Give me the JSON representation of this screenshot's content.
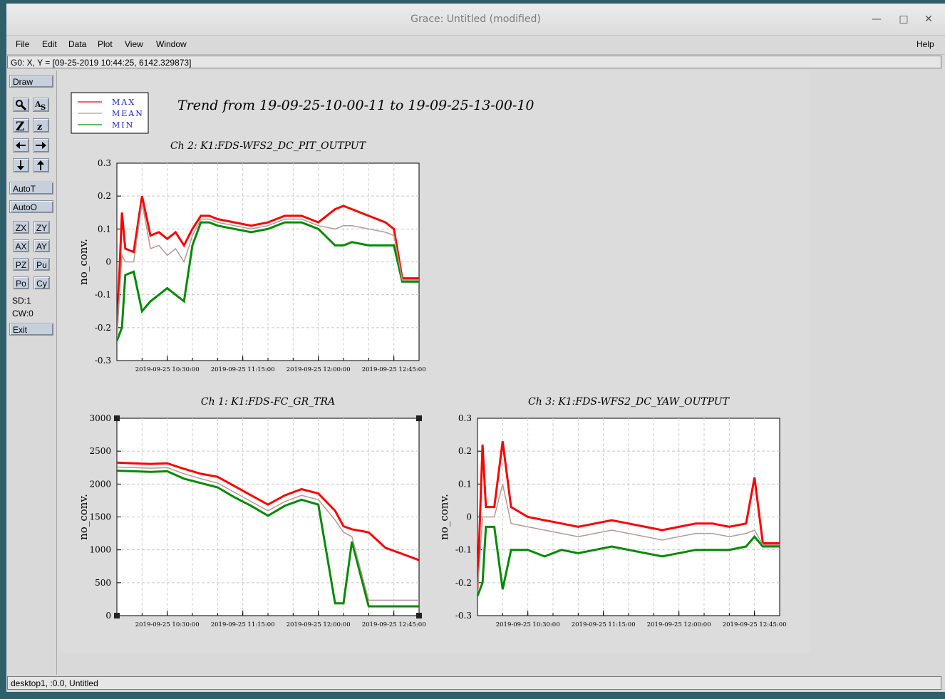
{
  "window": {
    "title": "Grace: Untitled (modified)"
  },
  "menu": {
    "file": "File",
    "edit": "Edit",
    "data": "Data",
    "plot": "Plot",
    "view": "View",
    "window": "Window",
    "help": "Help"
  },
  "locator": "G0: X, Y = [09-25-2019 10:44:25, 6142.329873]",
  "toolbar": {
    "draw": "Draw",
    "autot": "AutoT",
    "autoo": "AutoO",
    "zx": "ZX",
    "zy": "ZY",
    "ax": "AX",
    "ay": "AY",
    "pz": "PZ",
    "pu": "Pu",
    "po": "Po",
    "cy": "Cy",
    "sd": "SD:1",
    "cw": "CW:0",
    "exit": "Exit"
  },
  "status": "desktop1, :0.0, Untitled",
  "colors": {
    "max": "#ff0000",
    "mean": "#b69896",
    "min": "#008c00"
  },
  "plot": {
    "title": "Trend from 19-09-25-10-00-11 to 19-09-25-13-00-10",
    "legend": [
      "MAX",
      "MEAN",
      "MIN"
    ]
  },
  "chart_data": [
    {
      "type": "line",
      "title": "Ch 2: K1:FDS-WFS2_DC_PIT_OUTPUT",
      "ylabel": "no_conv.",
      "xlabel": "",
      "ylim": [
        -0.3,
        0.3
      ],
      "yticks": [
        "0.3",
        "0.2",
        "0.1",
        "0",
        "-0.1",
        "-0.2",
        "-0.3"
      ],
      "xticks": [
        "2019-09-25 10:30:00",
        "2019-09-25 11:15:00",
        "2019-09-25 12:00:00",
        "2019-09-25 12:45:00"
      ],
      "x": [
        "10:00",
        "10:03",
        "10:05",
        "10:10",
        "10:15",
        "10:20",
        "10:25",
        "10:30",
        "10:35",
        "10:40",
        "10:45",
        "10:50",
        "10:55",
        "11:00",
        "11:10",
        "11:20",
        "11:30",
        "11:40",
        "11:50",
        "12:00",
        "12:10",
        "12:15",
        "12:20",
        "12:30",
        "12:40",
        "12:45",
        "12:50",
        "12:55",
        "13:00"
      ],
      "series": [
        {
          "name": "MAX",
          "values": [
            -0.22,
            0.15,
            0.04,
            0.03,
            0.2,
            0.08,
            0.09,
            0.07,
            0.09,
            0.05,
            0.1,
            0.14,
            0.14,
            0.13,
            0.12,
            0.11,
            0.12,
            0.14,
            0.14,
            0.12,
            0.16,
            0.17,
            0.16,
            0.14,
            0.12,
            0.1,
            -0.05,
            -0.05,
            -0.05
          ]
        },
        {
          "name": "MEAN",
          "values": [
            -0.23,
            0.02,
            0.0,
            0.0,
            0.18,
            0.04,
            0.05,
            0.02,
            0.04,
            0.0,
            0.08,
            0.13,
            0.13,
            0.12,
            0.11,
            0.1,
            0.11,
            0.13,
            0.13,
            0.11,
            0.1,
            0.11,
            0.11,
            0.1,
            0.09,
            0.08,
            -0.055,
            -0.055,
            -0.055
          ]
        },
        {
          "name": "MIN",
          "values": [
            -0.24,
            -0.2,
            -0.04,
            -0.03,
            -0.15,
            -0.12,
            -0.1,
            -0.08,
            -0.1,
            -0.12,
            0.05,
            0.12,
            0.12,
            0.11,
            0.1,
            0.09,
            0.1,
            0.12,
            0.12,
            0.1,
            0.05,
            0.05,
            0.06,
            0.05,
            0.05,
            0.05,
            -0.06,
            -0.06,
            -0.06
          ]
        }
      ]
    },
    {
      "type": "line",
      "title": "Ch 1: K1:FDS-FC_GR_TRA",
      "ylabel": "no_conv.",
      "xlabel": "",
      "ylim": [
        -200,
        3000
      ],
      "yticks": [
        "3000",
        "2500",
        "2000",
        "1500",
        "1000",
        "500",
        "0"
      ],
      "xticks": [
        "2019-09-25 10:30:00",
        "2019-09-25 11:15:00",
        "2019-09-25 12:00:00",
        "2019-09-25 12:45:00"
      ],
      "x": [
        "10:00",
        "10:10",
        "10:20",
        "10:30",
        "10:40",
        "10:50",
        "11:00",
        "11:10",
        "11:20",
        "11:30",
        "11:40",
        "11:50",
        "12:00",
        "12:10",
        "12:15",
        "12:20",
        "12:30",
        "12:40",
        "12:50",
        "13:00"
      ],
      "series": [
        {
          "name": "MAX",
          "values": [
            2280,
            2270,
            2260,
            2270,
            2180,
            2100,
            2050,
            1900,
            1750,
            1600,
            1750,
            1850,
            1780,
            1500,
            1250,
            1200,
            1150,
            900,
            800,
            700
          ]
        },
        {
          "name": "MEAN",
          "values": [
            2210,
            2200,
            2190,
            2200,
            2100,
            2020,
            1950,
            1800,
            1650,
            1500,
            1650,
            1750,
            1680,
            1350,
            1150,
            1080,
            50,
            50,
            50,
            50
          ]
        },
        {
          "name": "MIN",
          "values": [
            2150,
            2140,
            2130,
            2140,
            2020,
            1950,
            1880,
            1720,
            1580,
            1420,
            1580,
            1680,
            1600,
            0,
            0,
            1000,
            -50,
            -50,
            -50,
            -50
          ]
        }
      ]
    },
    {
      "type": "line",
      "title": "Ch 3: K1:FDS-WFS2_DC_YAW_OUTPUT",
      "ylabel": "no_conv.",
      "xlabel": "",
      "ylim": [
        -0.3,
        0.3
      ],
      "yticks": [
        "0.3",
        "0.2",
        "0.1",
        "0",
        "-0.1",
        "-0.2",
        "-0.3"
      ],
      "xticks": [
        "2019-09-25 10:30:00",
        "2019-09-25 11:15:00",
        "2019-09-25 12:00:00",
        "2019-09-25 12:45:00"
      ],
      "x": [
        "10:00",
        "10:03",
        "10:05",
        "10:10",
        "10:15",
        "10:20",
        "10:30",
        "10:40",
        "10:50",
        "11:00",
        "11:10",
        "11:20",
        "11:30",
        "11:40",
        "11:50",
        "12:00",
        "12:10",
        "12:20",
        "12:30",
        "12:40",
        "12:45",
        "12:50",
        "13:00"
      ],
      "series": [
        {
          "name": "MAX",
          "values": [
            -0.22,
            0.22,
            0.03,
            0.03,
            0.23,
            0.03,
            0.0,
            -0.01,
            -0.02,
            -0.03,
            -0.02,
            -0.01,
            -0.02,
            -0.03,
            -0.04,
            -0.03,
            -0.02,
            -0.02,
            -0.03,
            -0.02,
            0.12,
            -0.08,
            -0.08
          ]
        },
        {
          "name": "MEAN",
          "values": [
            -0.23,
            0.0,
            0.0,
            0.0,
            0.1,
            -0.02,
            -0.03,
            -0.04,
            -0.05,
            -0.06,
            -0.05,
            -0.04,
            -0.05,
            -0.06,
            -0.07,
            -0.06,
            -0.05,
            -0.05,
            -0.06,
            -0.05,
            -0.04,
            -0.085,
            -0.085
          ]
        },
        {
          "name": "MIN",
          "values": [
            -0.24,
            -0.2,
            -0.03,
            -0.03,
            -0.22,
            -0.1,
            -0.1,
            -0.12,
            -0.1,
            -0.11,
            -0.1,
            -0.09,
            -0.1,
            -0.11,
            -0.12,
            -0.11,
            -0.1,
            -0.1,
            -0.1,
            -0.09,
            -0.06,
            -0.09,
            -0.09
          ]
        }
      ]
    }
  ]
}
